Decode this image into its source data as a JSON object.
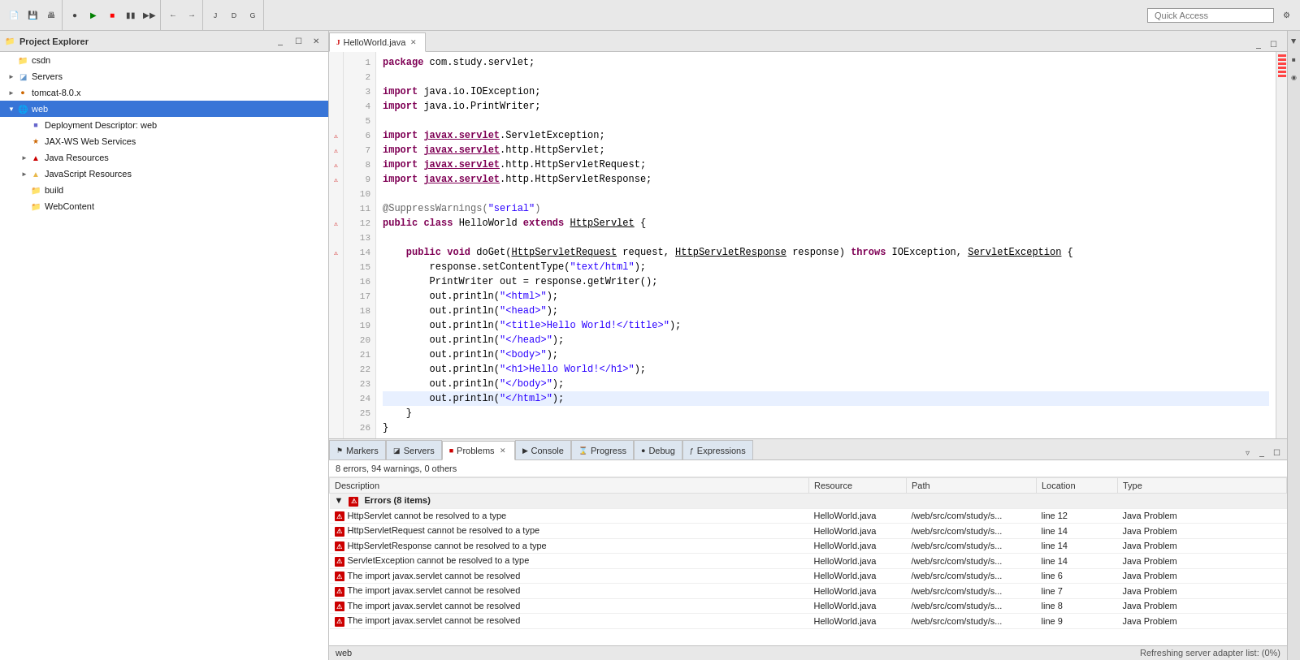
{
  "toolbar": {
    "quick_access_label": "Quick Access",
    "quick_access_placeholder": "Quick Access"
  },
  "project_explorer": {
    "title": "Project Explorer",
    "items": [
      {
        "id": "csdn",
        "label": "csdn",
        "level": 0,
        "type": "folder",
        "expanded": false,
        "arrow": false
      },
      {
        "id": "servers",
        "label": "Servers",
        "level": 0,
        "type": "folder",
        "expanded": false,
        "arrow": true
      },
      {
        "id": "tomcat",
        "label": "tomcat-8.0.x",
        "level": 0,
        "type": "server",
        "expanded": false,
        "arrow": true
      },
      {
        "id": "web",
        "label": "web",
        "level": 0,
        "type": "web",
        "expanded": true,
        "arrow": true,
        "selected": true
      },
      {
        "id": "deployment",
        "label": "Deployment Descriptor: web",
        "level": 1,
        "type": "deploy",
        "expanded": false,
        "arrow": false
      },
      {
        "id": "jaxws",
        "label": "JAX-WS Web Services",
        "level": 1,
        "type": "jaxws",
        "expanded": false,
        "arrow": false
      },
      {
        "id": "java-resources",
        "label": "Java Resources",
        "level": 1,
        "type": "java",
        "expanded": false,
        "arrow": true
      },
      {
        "id": "js-resources",
        "label": "JavaScript Resources",
        "level": 1,
        "type": "js",
        "expanded": false,
        "arrow": true
      },
      {
        "id": "build",
        "label": "build",
        "level": 1,
        "type": "folder",
        "expanded": false,
        "arrow": false
      },
      {
        "id": "webcontent",
        "label": "WebContent",
        "level": 1,
        "type": "folder",
        "expanded": false,
        "arrow": false
      }
    ]
  },
  "editor": {
    "tab_label": "HelloWorld.java",
    "lines": [
      {
        "num": 1,
        "content": "package com.study.servlet;",
        "tokens": [
          {
            "t": "kw",
            "v": "package"
          },
          {
            "t": "plain",
            "v": " com.study.servlet;"
          }
        ]
      },
      {
        "num": 2,
        "content": "",
        "tokens": []
      },
      {
        "num": 3,
        "content": "import java.io.IOException;",
        "tokens": [
          {
            "t": "kw",
            "v": "import"
          },
          {
            "t": "plain",
            "v": " java.io.IOException;"
          }
        ]
      },
      {
        "num": 4,
        "content": "import java.io.PrintWriter;",
        "tokens": [
          {
            "t": "kw",
            "v": "import"
          },
          {
            "t": "plain",
            "v": " java.io.PrintWriter;"
          }
        ]
      },
      {
        "num": 5,
        "content": "",
        "tokens": []
      },
      {
        "num": 6,
        "content": "import javax.servlet.ServletException;",
        "tokens": [
          {
            "t": "kw",
            "v": "import"
          },
          {
            "t": "plain",
            "v": " "
          },
          {
            "t": "underline",
            "v": "javax.servlet"
          },
          {
            "t": "plain",
            "v": ".ServletException;"
          }
        ],
        "has_icon": true
      },
      {
        "num": 7,
        "content": "import javax.servlet.http.HttpServlet;",
        "tokens": [
          {
            "t": "kw",
            "v": "import"
          },
          {
            "t": "plain",
            "v": " "
          },
          {
            "t": "underline",
            "v": "javax.servlet"
          },
          {
            "t": "plain",
            "v": ".http.HttpServlet;"
          }
        ],
        "has_icon": true
      },
      {
        "num": 8,
        "content": "import javax.servlet.http.HttpServletRequest;",
        "tokens": [
          {
            "t": "kw",
            "v": "import"
          },
          {
            "t": "plain",
            "v": " "
          },
          {
            "t": "underline",
            "v": "javax.servlet"
          },
          {
            "t": "plain",
            "v": ".http.HttpServletRequest;"
          }
        ],
        "has_icon": true
      },
      {
        "num": 9,
        "content": "import javax.servlet.http.HttpServletResponse;",
        "tokens": [
          {
            "t": "kw",
            "v": "import"
          },
          {
            "t": "plain",
            "v": " "
          },
          {
            "t": "underline",
            "v": "javax.servlet"
          },
          {
            "t": "plain",
            "v": ".http.HttpServletResponse;"
          }
        ],
        "has_icon": true
      },
      {
        "num": 10,
        "content": "",
        "tokens": []
      },
      {
        "num": 11,
        "content": "@SuppressWarnings(\"serial\")",
        "tokens": [
          {
            "t": "annotation",
            "v": "@SuppressWarnings"
          },
          {
            "t": "plain",
            "v": "("
          },
          {
            "t": "str",
            "v": "\"serial\""
          },
          {
            "t": "plain",
            "v": ")"
          }
        ]
      },
      {
        "num": 12,
        "content": "public class HelloWorld extends HttpServlet {",
        "tokens": [
          {
            "t": "kw",
            "v": "public"
          },
          {
            "t": "plain",
            "v": " "
          },
          {
            "t": "kw",
            "v": "class"
          },
          {
            "t": "plain",
            "v": " HelloWorld "
          },
          {
            "t": "kw",
            "v": "extends"
          },
          {
            "t": "plain",
            "v": " "
          },
          {
            "t": "underline",
            "v": "HttpServlet"
          },
          {
            "t": "plain",
            "v": " {"
          }
        ],
        "has_icon": true
      },
      {
        "num": 13,
        "content": "",
        "tokens": []
      },
      {
        "num": 14,
        "content": "    public void doGet(HttpServletRequest request, HttpServletResponse response) throws IOException, ServletException {",
        "tokens": [
          {
            "t": "plain",
            "v": "    "
          },
          {
            "t": "kw",
            "v": "public"
          },
          {
            "t": "plain",
            "v": " "
          },
          {
            "t": "kw",
            "v": "void"
          },
          {
            "t": "plain",
            "v": " doGet("
          },
          {
            "t": "underline",
            "v": "HttpServletRequest"
          },
          {
            "t": "plain",
            "v": " request, "
          },
          {
            "t": "underline",
            "v": "HttpServletResponse"
          },
          {
            "t": "plain",
            "v": " response) throws IOException, "
          },
          {
            "t": "underline",
            "v": "ServletException"
          },
          {
            "t": "plain",
            "v": " {"
          }
        ],
        "has_icon": true
      },
      {
        "num": 15,
        "content": "        response.setContentType(\"text/html\");",
        "tokens": [
          {
            "t": "plain",
            "v": "        response.setContentType("
          },
          {
            "t": "str",
            "v": "\"text/html\""
          },
          {
            "t": "plain",
            "v": ");"
          }
        ]
      },
      {
        "num": 16,
        "content": "        PrintWriter out = response.getWriter();",
        "tokens": [
          {
            "t": "plain",
            "v": "        PrintWriter out = response.getWriter();"
          }
        ]
      },
      {
        "num": 17,
        "content": "        out.println(\"<html>\");",
        "tokens": [
          {
            "t": "plain",
            "v": "        out.println("
          },
          {
            "t": "str",
            "v": "\"<html>\""
          },
          {
            "t": "plain",
            "v": ");"
          }
        ]
      },
      {
        "num": 18,
        "content": "        out.println(\"<head>\");",
        "tokens": [
          {
            "t": "plain",
            "v": "        out.println("
          },
          {
            "t": "str",
            "v": "\"<head>\""
          },
          {
            "t": "plain",
            "v": ");"
          }
        ]
      },
      {
        "num": 19,
        "content": "        out.println(\"<title>Hello World!</title>\");",
        "tokens": [
          {
            "t": "plain",
            "v": "        out.println("
          },
          {
            "t": "str",
            "v": "\"<title>Hello World!</title>\""
          },
          {
            "t": "plain",
            "v": ");"
          }
        ]
      },
      {
        "num": 20,
        "content": "        out.println(\"</head>\");",
        "tokens": [
          {
            "t": "plain",
            "v": "        out.println("
          },
          {
            "t": "str",
            "v": "\"</head>\""
          },
          {
            "t": "plain",
            "v": ");"
          }
        ]
      },
      {
        "num": 21,
        "content": "        out.println(\"<body>\");",
        "tokens": [
          {
            "t": "plain",
            "v": "        out.println("
          },
          {
            "t": "str",
            "v": "\"<body>\""
          },
          {
            "t": "plain",
            "v": ");"
          }
        ]
      },
      {
        "num": 22,
        "content": "        out.println(\"<h1>Hello World!</h1>\");",
        "tokens": [
          {
            "t": "plain",
            "v": "        out.println("
          },
          {
            "t": "str",
            "v": "\"<h1>Hello World!</h1>\""
          },
          {
            "t": "plain",
            "v": ");"
          }
        ]
      },
      {
        "num": 23,
        "content": "        out.println(\"</body>\");",
        "tokens": [
          {
            "t": "plain",
            "v": "        out.println("
          },
          {
            "t": "str",
            "v": "\"</body>\""
          },
          {
            "t": "plain",
            "v": ");"
          }
        ]
      },
      {
        "num": 24,
        "content": "        out.println(\"</html>\");",
        "tokens": [
          {
            "t": "plain",
            "v": "        out.println("
          },
          {
            "t": "str",
            "v": "\"</html>\""
          },
          {
            "t": "plain",
            "v": ");"
          }
        ],
        "highlighted": true
      },
      {
        "num": 25,
        "content": "    }",
        "tokens": [
          {
            "t": "plain",
            "v": "    }"
          }
        ]
      },
      {
        "num": 26,
        "content": "}",
        "tokens": [
          {
            "t": "plain",
            "v": "}"
          }
        ]
      }
    ]
  },
  "bottom_panel": {
    "tabs": [
      {
        "id": "markers",
        "label": "Markers",
        "active": false
      },
      {
        "id": "servers",
        "label": "Servers",
        "active": false
      },
      {
        "id": "problems",
        "label": "Problems",
        "active": true
      },
      {
        "id": "console",
        "label": "Console",
        "active": false
      },
      {
        "id": "progress",
        "label": "Progress",
        "active": false
      },
      {
        "id": "debug",
        "label": "Debug",
        "active": false
      },
      {
        "id": "expressions",
        "label": "Expressions",
        "active": false
      }
    ],
    "problems_summary": "8 errors, 94 warnings, 0 others",
    "columns": [
      "Description",
      "Resource",
      "Path",
      "Location",
      "Type"
    ],
    "errors_group_label": "Errors (8 items)",
    "errors": [
      {
        "desc": "HttpServlet cannot be resolved to a type",
        "resource": "HelloWorld.java",
        "path": "/web/src/com/study/s...",
        "location": "line 12",
        "type": "Java Problem"
      },
      {
        "desc": "HttpServletRequest cannot be resolved to a type",
        "resource": "HelloWorld.java",
        "path": "/web/src/com/study/s...",
        "location": "line 14",
        "type": "Java Problem"
      },
      {
        "desc": "HttpServletResponse cannot be resolved to a type",
        "resource": "HelloWorld.java",
        "path": "/web/src/com/study/s...",
        "location": "line 14",
        "type": "Java Problem"
      },
      {
        "desc": "ServletException cannot be resolved to a type",
        "resource": "HelloWorld.java",
        "path": "/web/src/com/study/s...",
        "location": "line 14",
        "type": "Java Problem"
      },
      {
        "desc": "The import javax.servlet cannot be resolved",
        "resource": "HelloWorld.java",
        "path": "/web/src/com/study/s...",
        "location": "line 6",
        "type": "Java Problem"
      },
      {
        "desc": "The import javax.servlet cannot be resolved",
        "resource": "HelloWorld.java",
        "path": "/web/src/com/study/s...",
        "location": "line 7",
        "type": "Java Problem"
      },
      {
        "desc": "The import javax.servlet cannot be resolved",
        "resource": "HelloWorld.java",
        "path": "/web/src/com/study/s...",
        "location": "line 8",
        "type": "Java Problem"
      },
      {
        "desc": "The import javax.servlet cannot be resolved",
        "resource": "HelloWorld.java",
        "path": "/web/src/com/study/s...",
        "location": "line 9",
        "type": "Java Problem"
      }
    ]
  },
  "status_bar": {
    "left": "web",
    "right": "Refreshing server adapter list: (0%)"
  }
}
